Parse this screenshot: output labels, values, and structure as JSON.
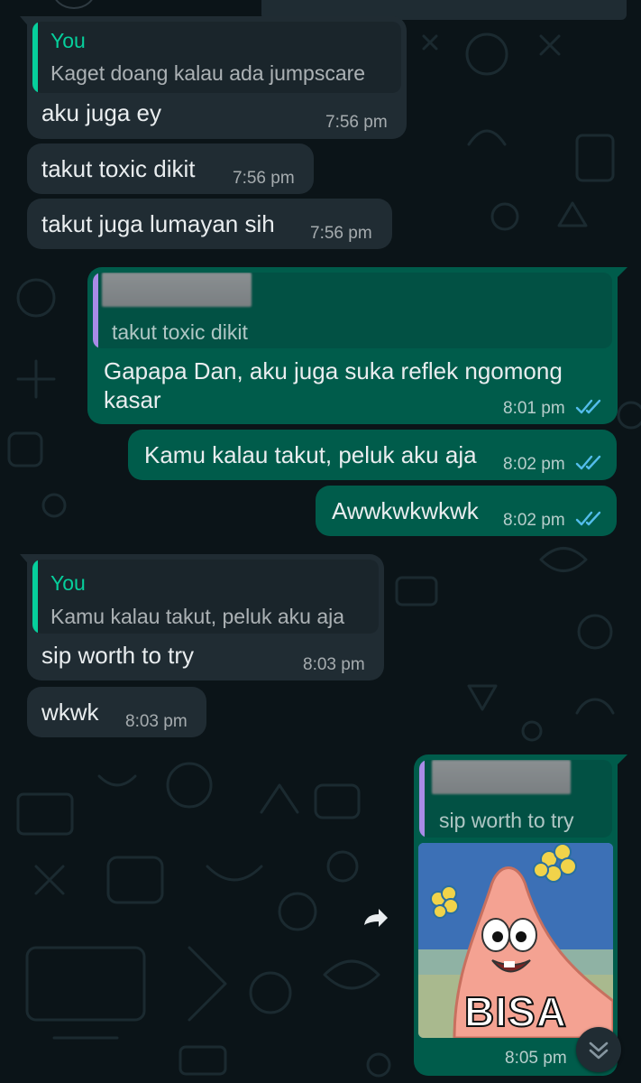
{
  "colors": {
    "background": "#0b1418",
    "incoming_bubble": "#202c33",
    "outgoing_bubble": "#005c4b",
    "quote_sender": "#06cf9c",
    "read_ticks": "#53bdeb"
  },
  "messages": [
    {
      "direction": "incoming",
      "quote": {
        "sender": "You",
        "text": "Kaget doang kalau ada jumpscare"
      },
      "text": "aku juga ey",
      "time": "7:56 pm"
    },
    {
      "direction": "incoming",
      "text": "takut toxic dikit",
      "time": "7:56 pm"
    },
    {
      "direction": "incoming",
      "text": "takut juga lumayan sih",
      "time": "7:56 pm"
    },
    {
      "direction": "outgoing",
      "quote": {
        "text": "takut toxic dikit"
      },
      "text_line1": "Gapapa Dan, aku juga suka reflek ngomong",
      "text_line2": "kasar",
      "time": "8:01 pm",
      "status": "read"
    },
    {
      "direction": "outgoing",
      "text": "Kamu kalau takut, peluk aku aja",
      "time": "8:02 pm",
      "status": "read"
    },
    {
      "direction": "outgoing",
      "text": "Awwkwkwkwk",
      "time": "8:02 pm",
      "status": "read"
    },
    {
      "direction": "incoming",
      "quote": {
        "sender": "You",
        "text": "Kamu kalau takut, peluk aku aja"
      },
      "text": "sip worth to try",
      "time": "8:03 pm"
    },
    {
      "direction": "incoming",
      "text": "wkwk",
      "time": "8:03 pm"
    },
    {
      "direction": "outgoing",
      "quote": {
        "text": "sip worth to try"
      },
      "image": {
        "caption": "BISA",
        "subject": "patrick-star-sticker"
      },
      "time": "8:05 pm"
    }
  ],
  "icons": {
    "forward": "forward-arrow-icon",
    "scroll_down": "double-chevron-down-icon",
    "read_ticks": "double-check-icon"
  }
}
